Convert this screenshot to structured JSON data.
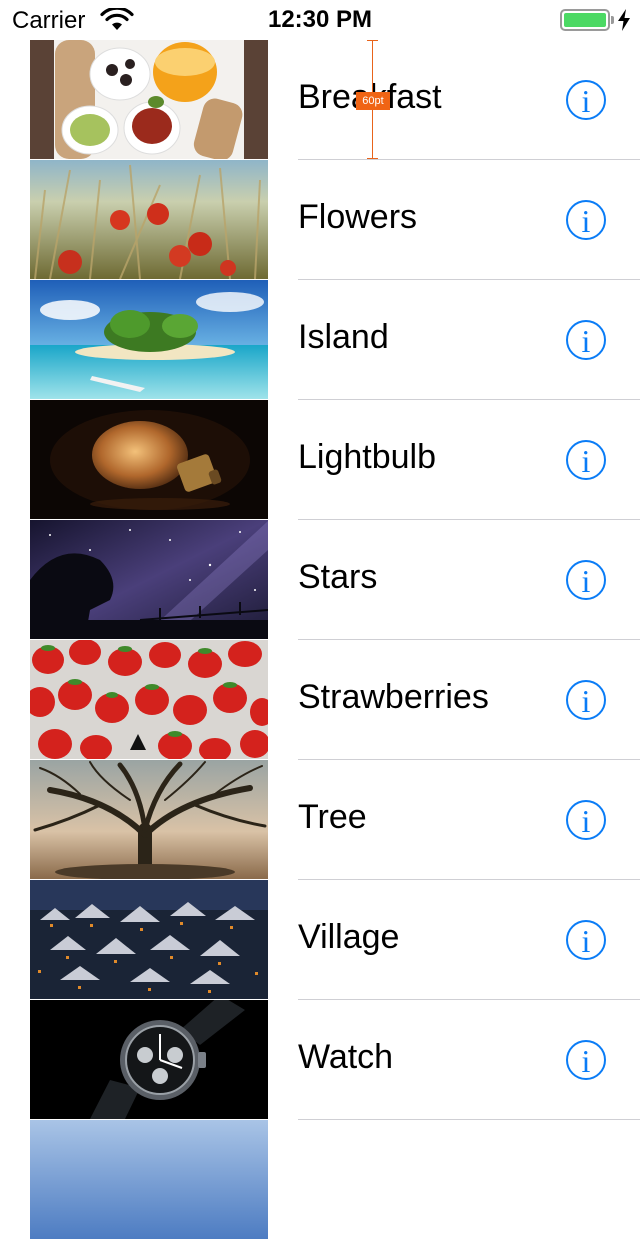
{
  "status_bar": {
    "carrier": "Carrier",
    "time": "12:30 PM",
    "battery_color": "#4cd964",
    "icons": [
      "wifi-icon",
      "battery-icon",
      "charging-bolt-icon"
    ]
  },
  "measurement": {
    "label": "60pt",
    "color": "#f06414"
  },
  "info_icon_color": "#0a7cf6",
  "rows": [
    {
      "title": "Breakfast"
    },
    {
      "title": "Flowers"
    },
    {
      "title": "Island"
    },
    {
      "title": "Lightbulb"
    },
    {
      "title": "Stars"
    },
    {
      "title": "Strawberries"
    },
    {
      "title": "Tree"
    },
    {
      "title": "Village"
    },
    {
      "title": "Watch"
    }
  ]
}
